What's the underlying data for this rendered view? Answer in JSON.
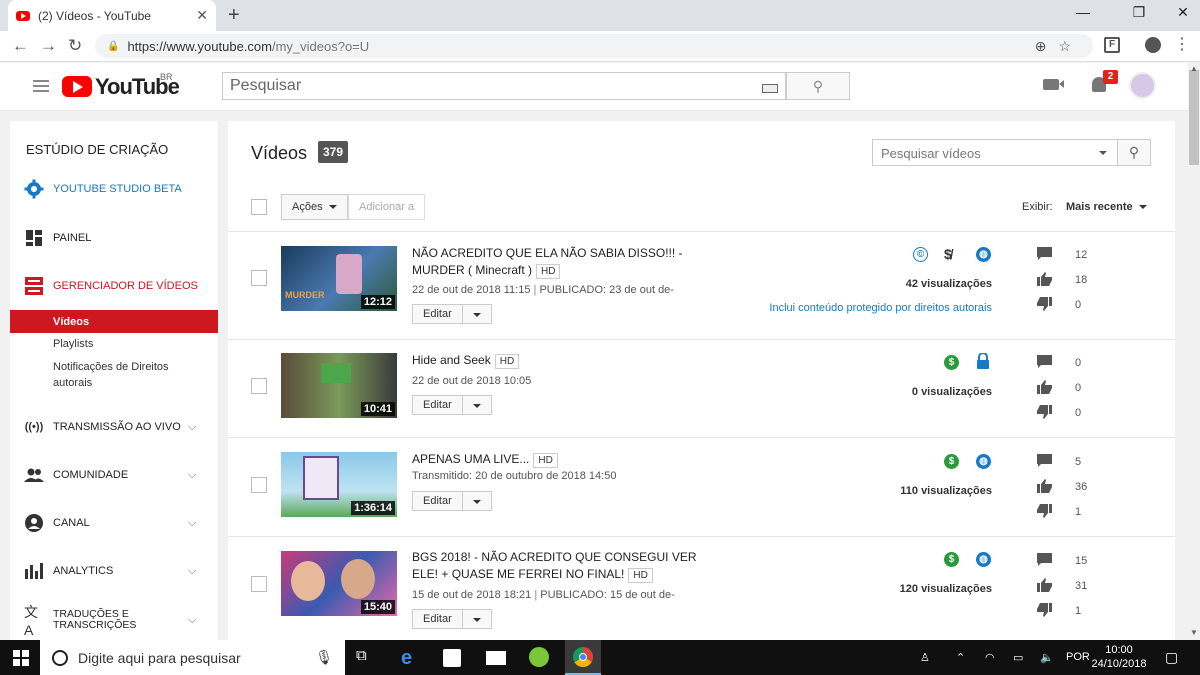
{
  "browser": {
    "tab_title": "(2) Vídeos - YouTube",
    "tab_close": "✕",
    "new_tab": "+",
    "window_controls": [
      "—",
      "❐",
      "✕"
    ],
    "url_host": "https://www.youtube.com",
    "url_path": "/my_videos?o=U",
    "ext_label": "F"
  },
  "header": {
    "logo_text": "YouTube",
    "country": "BR",
    "search_placeholder": "Pesquisar",
    "notifications": "2"
  },
  "sidebar": {
    "title": "ESTÚDIO DE CRIAÇÃO",
    "items": [
      {
        "label": "YOUTUBE STUDIO BETA",
        "color": "#167ac6"
      },
      {
        "label": "PAINEL",
        "color": "#222"
      },
      {
        "label": "GERENCIADOR DE VÍDEOS",
        "color": "#cc181e"
      },
      {
        "label": "TRANSMISSÃO AO VIVO",
        "color": "#222"
      },
      {
        "label": "COMUNIDADE",
        "color": "#222"
      },
      {
        "label": "CANAL",
        "color": "#222"
      },
      {
        "label": "ANALYTICS",
        "color": "#222"
      },
      {
        "label": "TRADUÇÕES E TRANSCRIÇÕES",
        "color": "#222"
      }
    ],
    "subitems": [
      "Vídeos",
      "Playlists",
      "Notificações de Direitos autorais"
    ]
  },
  "main": {
    "title": "Vídeos",
    "count": "379",
    "search_placeholder": "Pesquisar vídeos",
    "actions_label": "Ações",
    "add_to_label": "Adicionar a",
    "show_label": "Exibir:",
    "sort_label": "Mais recente",
    "edit_label": "Editar",
    "videos": [
      {
        "title": "NÃO ACREDITO QUE ELA NÃO SABIA DISSO!!! - MURDER ( Minecraft )",
        "hd": "HD",
        "duration": "12:12",
        "date": "22 de out de 2018 11:15",
        "published": "PUBLICADO: 23 de out de-",
        "views": "42 visualizações",
        "copyright_note": "Inclui conteúdo protegido por direitos autorais",
        "comments": "12",
        "likes": "18",
        "dislikes": "0",
        "thumb_colors": [
          "#1a3b5c",
          "#4a7ab0",
          "#2d5a3a"
        ]
      },
      {
        "title": "Hide and Seek",
        "hd": "HD",
        "duration": "10:41",
        "date": "22 de out de 2018 10:05",
        "published": "",
        "views": "0 visualizações",
        "copyright_note": "",
        "comments": "0",
        "likes": "0",
        "dislikes": "0",
        "thumb_colors": [
          "#5a4a3a",
          "#7a9a5a",
          "#3a3a3a"
        ]
      },
      {
        "title": "APENAS UMA LIVE...",
        "hd": "HD",
        "duration": "1:36:14",
        "date": "Transmitido: 20 de outubro de 2018 14:50",
        "published": "",
        "views": "110 visualizações",
        "copyright_note": "",
        "comments": "5",
        "likes": "36",
        "dislikes": "1",
        "thumb_colors": [
          "#8ac8e8",
          "#e8d8f0",
          "#5aa85a"
        ]
      },
      {
        "title": "BGS 2018! - NÃO ACREDITO QUE CONSEGUI VER ELE! + QUASE ME FERREI NO FINAL!",
        "hd": "HD",
        "duration": "15:40",
        "date": "15 de out de 2018 18:21",
        "published": "PUBLICADO: 15 de out de-",
        "views": "120 visualizações",
        "copyright_note": "",
        "comments": "15",
        "likes": "31",
        "dislikes": "1",
        "thumb_colors": [
          "#c83a7a",
          "#3a5ab0",
          "#e86aa8"
        ]
      }
    ]
  },
  "taskbar": {
    "search_placeholder": "Digite aqui para pesquisar",
    "lang": "POR",
    "time": "10:00",
    "date": "24/10/2018"
  }
}
